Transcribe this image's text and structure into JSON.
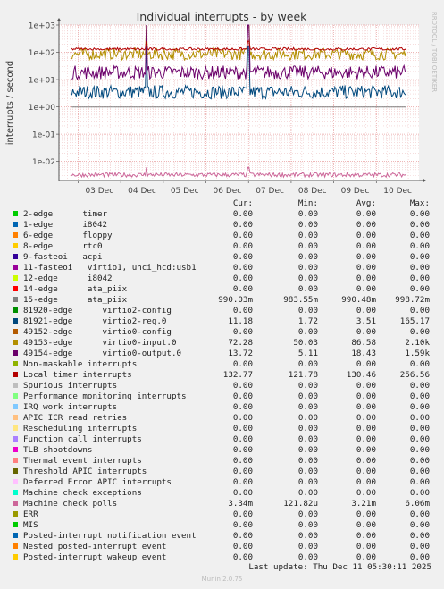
{
  "chart_data": {
    "type": "line",
    "title": "Individual interrupts - by week",
    "ylabel": "interrupts / second",
    "side_label": "RRDTOOL / TOBI OETIKER",
    "scale": "log",
    "ylim": [
      0.002,
      1000
    ],
    "y_ticks": [
      "1e-02",
      "1e-01",
      "1e+00",
      "1e+01",
      "1e+02",
      "1e+03"
    ],
    "x_ticks": [
      "03 Dec",
      "04 Dec",
      "05 Dec",
      "06 Dec",
      "07 Dec",
      "08 Dec",
      "09 Dec",
      "10 Dec"
    ],
    "columns": [
      "Cur:",
      "Min:",
      "Avg:",
      "Max:"
    ],
    "series": [
      {
        "name": "2-edge      timer",
        "color": "#00cc00",
        "cur": "0.00",
        "min": "0.00",
        "avg": "0.00",
        "max": "0.00"
      },
      {
        "name": "1-edge      i8042",
        "color": "#0066b3",
        "cur": "0.00",
        "min": "0.00",
        "avg": "0.00",
        "max": "0.00"
      },
      {
        "name": "6-edge      floppy",
        "color": "#ff8000",
        "cur": "0.00",
        "min": "0.00",
        "avg": "0.00",
        "max": "0.00"
      },
      {
        "name": "8-edge      rtc0",
        "color": "#ffcc00",
        "cur": "0.00",
        "min": "0.00",
        "avg": "0.00",
        "max": "0.00"
      },
      {
        "name": "9-fasteoi   acpi",
        "color": "#330099",
        "cur": "0.00",
        "min": "0.00",
        "avg": "0.00",
        "max": "0.00"
      },
      {
        "name": "11-fasteoi   virtio1, uhci_hcd:usb1",
        "color": "#990099",
        "cur": "0.00",
        "min": "0.00",
        "avg": "0.00",
        "max": "0.00"
      },
      {
        "name": "12-edge      i8042",
        "color": "#ccff00",
        "cur": "0.00",
        "min": "0.00",
        "avg": "0.00",
        "max": "0.00"
      },
      {
        "name": "14-edge      ata_piix",
        "color": "#ff0000",
        "cur": "0.00",
        "min": "0.00",
        "avg": "0.00",
        "max": "0.00"
      },
      {
        "name": "15-edge      ata_piix",
        "color": "#808080",
        "cur": "990.03m",
        "min": "983.55m",
        "avg": "990.48m",
        "max": "998.72m"
      },
      {
        "name": "81920-edge      virtio2-config",
        "color": "#008f00",
        "cur": "0.00",
        "min": "0.00",
        "avg": "0.00",
        "max": "0.00"
      },
      {
        "name": "81921-edge      virtio2-req.0",
        "color": "#00487d",
        "cur": "11.18",
        "min": "1.72",
        "avg": "3.51",
        "max": "165.17"
      },
      {
        "name": "49152-edge      virtio0-config",
        "color": "#b35a00",
        "cur": "0.00",
        "min": "0.00",
        "avg": "0.00",
        "max": "0.00"
      },
      {
        "name": "49153-edge      virtio0-input.0",
        "color": "#b38f00",
        "cur": "72.28",
        "min": "50.03",
        "avg": "86.58",
        "max": "2.10k"
      },
      {
        "name": "49154-edge      virtio0-output.0",
        "color": "#6b006b",
        "cur": "13.72",
        "min": "5.11",
        "avg": "18.43",
        "max": "1.59k"
      },
      {
        "name": "Non-maskable interrupts",
        "color": "#8fb300",
        "cur": "0.00",
        "min": "0.00",
        "avg": "0.00",
        "max": "0.00"
      },
      {
        "name": "Local timer interrupts",
        "color": "#b30000",
        "cur": "132.77",
        "min": "121.78",
        "avg": "130.46",
        "max": "256.56"
      },
      {
        "name": "Spurious interrupts",
        "color": "#bebebe",
        "cur": "0.00",
        "min": "0.00",
        "avg": "0.00",
        "max": "0.00"
      },
      {
        "name": "Performance monitoring interrupts",
        "color": "#80ff80",
        "cur": "0.00",
        "min": "0.00",
        "avg": "0.00",
        "max": "0.00"
      },
      {
        "name": "IRQ work interrupts",
        "color": "#80c9ff",
        "cur": "0.00",
        "min": "0.00",
        "avg": "0.00",
        "max": "0.00"
      },
      {
        "name": "APIC ICR read retries",
        "color": "#ffc080",
        "cur": "0.00",
        "min": "0.00",
        "avg": "0.00",
        "max": "0.00"
      },
      {
        "name": "Rescheduling interrupts",
        "color": "#ffe680",
        "cur": "0.00",
        "min": "0.00",
        "avg": "0.00",
        "max": "0.00"
      },
      {
        "name": "Function call interrupts",
        "color": "#aa80ff",
        "cur": "0.00",
        "min": "0.00",
        "avg": "0.00",
        "max": "0.00"
      },
      {
        "name": "TLB shootdowns",
        "color": "#ee00cc",
        "cur": "0.00",
        "min": "0.00",
        "avg": "0.00",
        "max": "0.00"
      },
      {
        "name": "Thermal event interrupts",
        "color": "#ff8080",
        "cur": "0.00",
        "min": "0.00",
        "avg": "0.00",
        "max": "0.00"
      },
      {
        "name": "Threshold APIC interrupts",
        "color": "#666600",
        "cur": "0.00",
        "min": "0.00",
        "avg": "0.00",
        "max": "0.00"
      },
      {
        "name": "Deferred Error APIC interrupts",
        "color": "#ffbfff",
        "cur": "0.00",
        "min": "0.00",
        "avg": "0.00",
        "max": "0.00"
      },
      {
        "name": "Machine check exceptions",
        "color": "#00ffcc",
        "cur": "0.00",
        "min": "0.00",
        "avg": "0.00",
        "max": "0.00"
      },
      {
        "name": "Machine check polls",
        "color": "#cc6699",
        "cur": "3.34m",
        "min": "121.82u",
        "avg": "3.21m",
        "max": "6.06m"
      },
      {
        "name": "ERR",
        "color": "#999900",
        "cur": "0.00",
        "min": "0.00",
        "avg": "0.00",
        "max": "0.00"
      },
      {
        "name": "MIS",
        "color": "#00cc00",
        "cur": "0.00",
        "min": "0.00",
        "avg": "0.00",
        "max": "0.00"
      },
      {
        "name": "Posted-interrupt notification event",
        "color": "#0066b3",
        "cur": "0.00",
        "min": "0.00",
        "avg": "0.00",
        "max": "0.00"
      },
      {
        "name": "Nested posted-interrupt event",
        "color": "#ff8000",
        "cur": "0.00",
        "min": "0.00",
        "avg": "0.00",
        "max": "0.00"
      },
      {
        "name": "Posted-interrupt wakeup event",
        "color": "#ffcc00",
        "cur": "0.00",
        "min": "0.00",
        "avg": "0.00",
        "max": "0.00"
      }
    ]
  },
  "footer": {
    "last_update": "Last update: Thu Dec 11 05:30:11 2025",
    "version": "Munin 2.0.75"
  }
}
